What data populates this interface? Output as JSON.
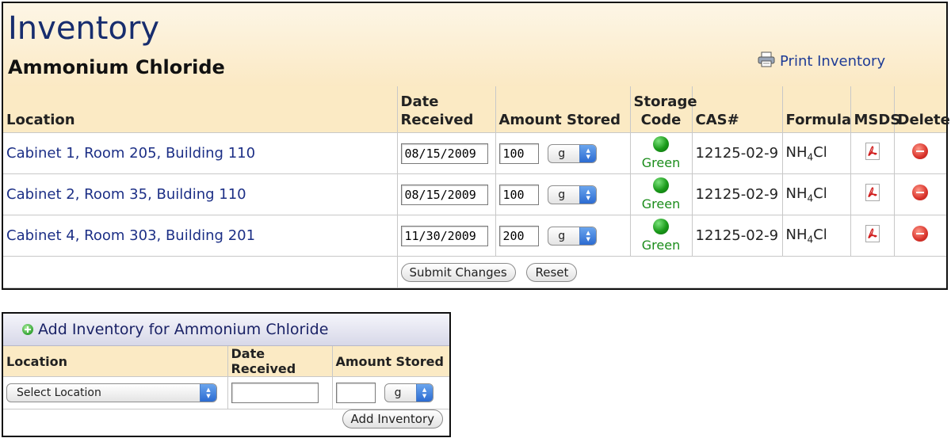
{
  "inventory": {
    "title": "Inventory",
    "chemical": "Ammonium Chloride",
    "print_label": "Print Inventory",
    "columns": {
      "location": "Location",
      "date_received_1": "Date",
      "date_received_2": "Received",
      "amount_stored": "Amount Stored",
      "storage_code_1": "Storage",
      "storage_code_2": "Code",
      "cas": "CAS#",
      "formula": "Formula",
      "msds": "MSDS",
      "delete": "Delete"
    },
    "rows": [
      {
        "location": "Cabinet 1, Room 205, Building 110",
        "date": "08/15/2009",
        "amount": "100",
        "unit": "g",
        "storage_code": "Green",
        "cas": "12125-02-9",
        "formula_main": "NH",
        "formula_sub": "4",
        "formula_end": "Cl"
      },
      {
        "location": "Cabinet 2, Room 35, Building 110",
        "date": "08/15/2009",
        "amount": "100",
        "unit": "g",
        "storage_code": "Green",
        "cas": "12125-02-9",
        "formula_main": "NH",
        "formula_sub": "4",
        "formula_end": "Cl"
      },
      {
        "location": "Cabinet 4, Room 303, Building 201",
        "date": "11/30/2009",
        "amount": "200",
        "unit": "g",
        "storage_code": "Green",
        "cas": "12125-02-9",
        "formula_main": "NH",
        "formula_sub": "4",
        "formula_end": "Cl"
      }
    ],
    "submit_label": "Submit Changes",
    "reset_label": "Reset"
  },
  "add_inventory": {
    "title": "Add Inventory for Ammonium Chloride",
    "columns": {
      "location": "Location",
      "date_received": "Date Received",
      "amount_stored": "Amount Stored"
    },
    "location_select": "Select Location",
    "date_value": "",
    "amount_value": "",
    "unit": "g",
    "add_label": "Add Inventory"
  },
  "colors": {
    "header_bg": "#fbeac4",
    "title": "#172d6e",
    "link": "#1c2f86",
    "storage_green": "#1a8c1a"
  },
  "icons": {
    "print": "printer-icon",
    "msds": "pdf-icon",
    "delete": "delete-icon",
    "storage": "green-light-icon",
    "add": "add-circle-icon"
  }
}
